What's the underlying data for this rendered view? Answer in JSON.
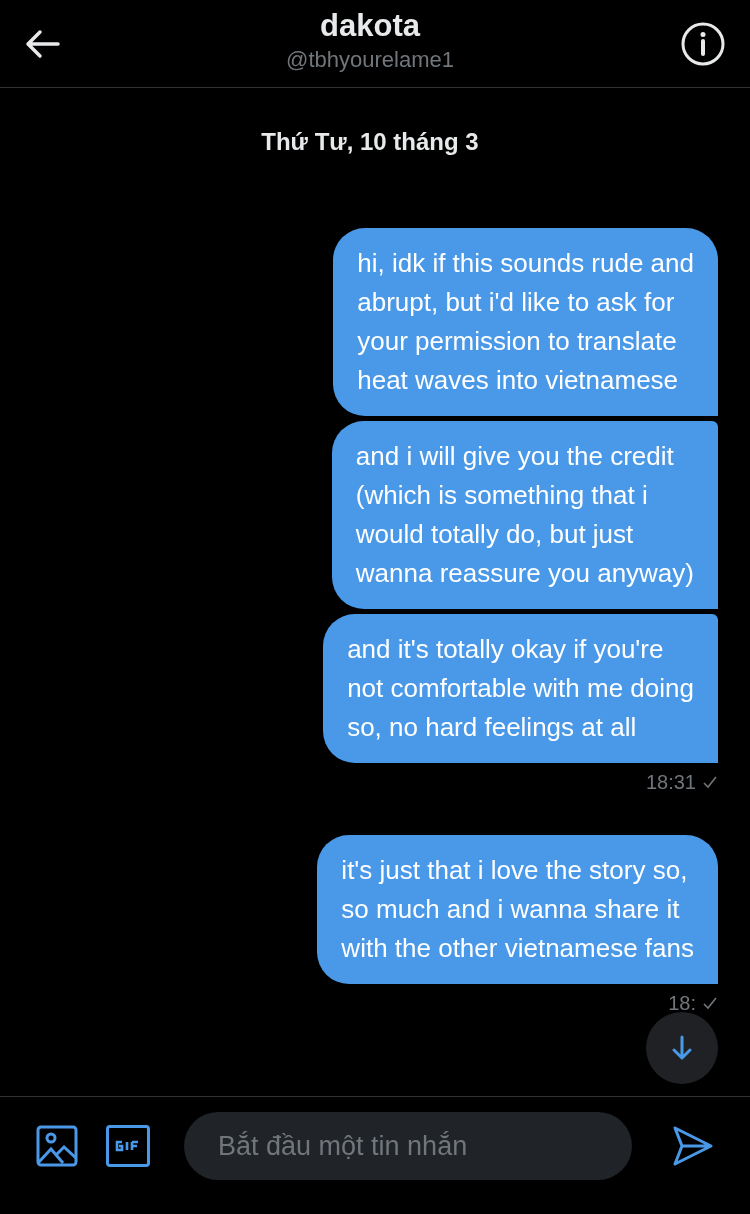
{
  "header": {
    "title": "dakota",
    "handle": "@tbhyourelame1"
  },
  "date_separator": "Thứ Tư, 10 tháng 3",
  "message_groups": [
    {
      "messages": [
        "hi, idk if this sounds rude and\nabrupt, but i'd like to ask for\nyour permission to translate\nheat waves into vietnamese",
        "and i will give you the credit\n(which is something that i\nwould totally do, but just\nwanna reassure you anyway)",
        "and it's totally okay if you're\nnot comfortable with me doing\nso, no hard feelings at all"
      ],
      "time": "18:31"
    },
    {
      "messages": [
        "it's just that i love the story so,\nso much and i wanna share it\nwith the other vietnamese fans"
      ],
      "time": "18:"
    }
  ],
  "composer": {
    "placeholder": "Bắt đầu một tin nhắn"
  }
}
